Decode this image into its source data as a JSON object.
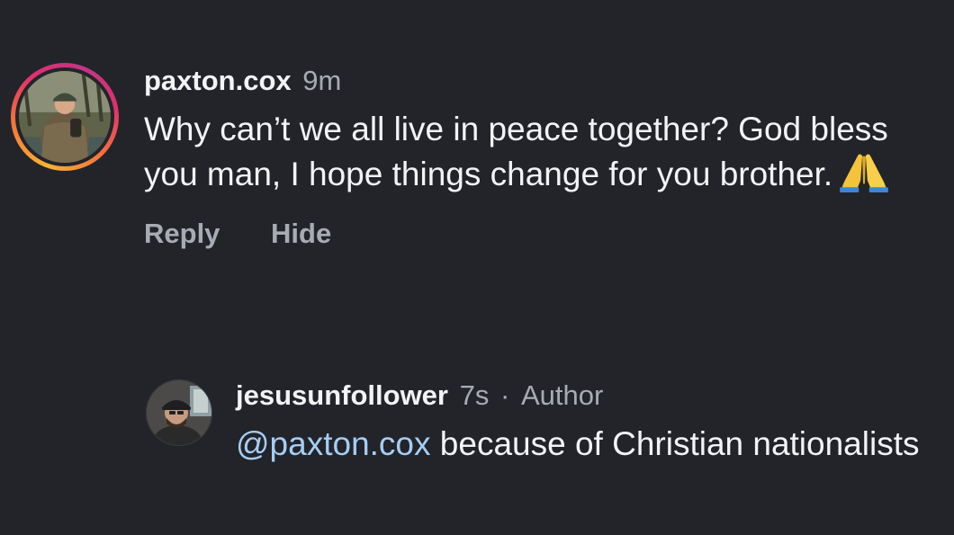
{
  "comments": [
    {
      "username": "paxton.cox",
      "time": "9m",
      "text": "Why can’t we all live in peace together? God bless you man, I hope things change for you brother.",
      "emoji": "folded-hands-emoji",
      "actions": {
        "reply": "Reply",
        "hide": "Hide"
      }
    },
    {
      "username": "jesusunfollower",
      "time": "7s",
      "separator": "·",
      "role": "Author",
      "mention": "@paxton.cox",
      "text": " because of Christian nationalists"
    }
  ],
  "colors": {
    "background": "#22242a",
    "text": "#f2f3f5",
    "muted": "#a8abb3",
    "mention": "#a6cdf3"
  }
}
